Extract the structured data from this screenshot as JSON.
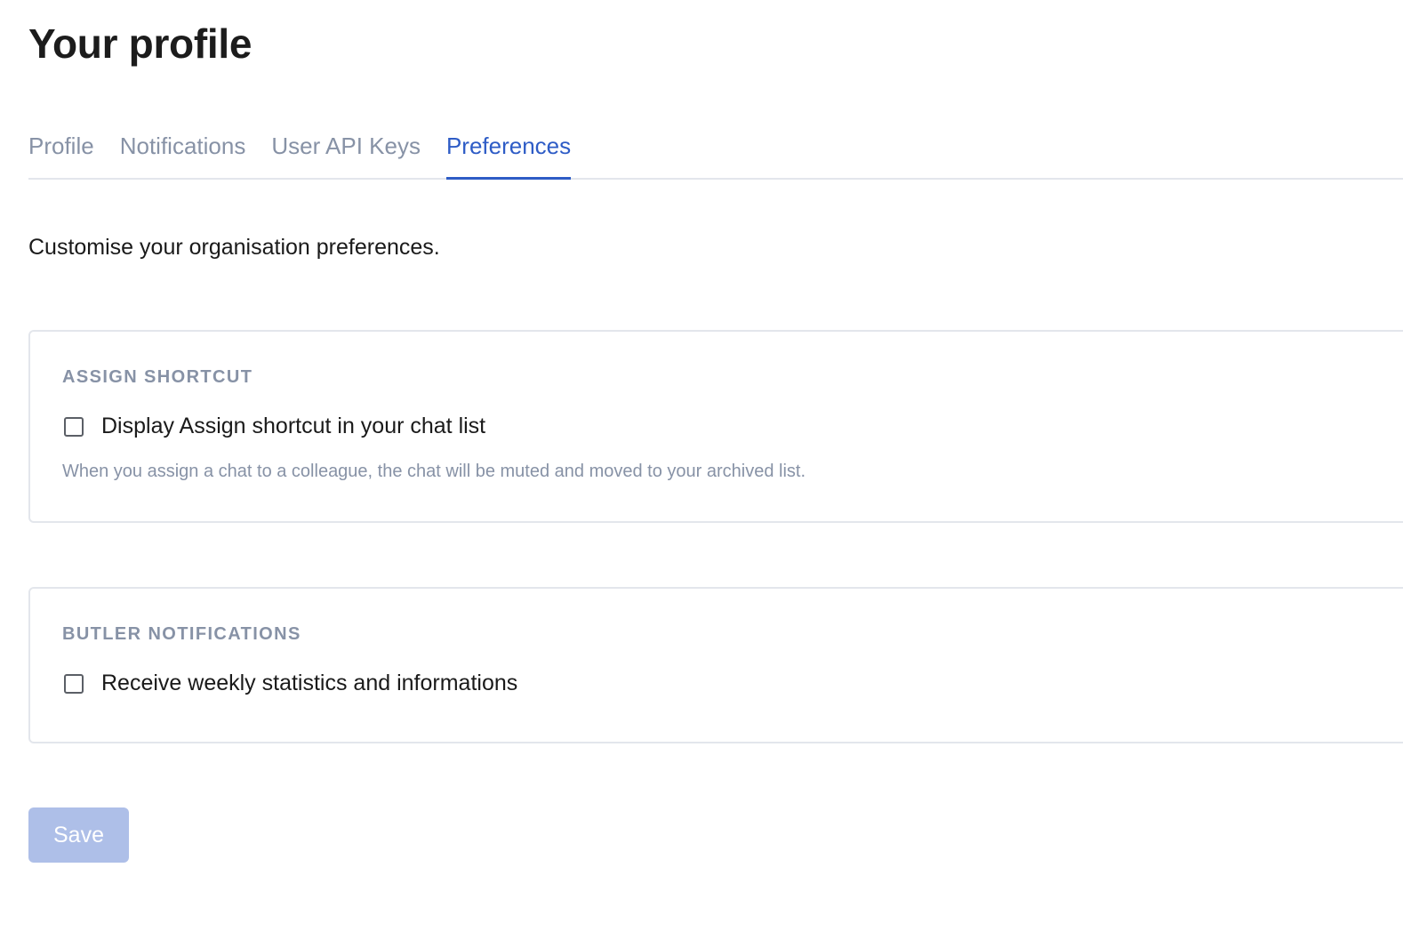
{
  "page": {
    "title": "Your profile",
    "intro": "Customise your organisation preferences."
  },
  "tabs": [
    {
      "label": "Profile",
      "active": false
    },
    {
      "label": "Notifications",
      "active": false
    },
    {
      "label": "User API Keys",
      "active": false
    },
    {
      "label": "Preferences",
      "active": true
    }
  ],
  "sections": {
    "assign_shortcut": {
      "title": "ASSIGN SHORTCUT",
      "checkbox_label": "Display Assign shortcut in your chat list",
      "checked": false,
      "help": "When you assign a chat to a colleague, the chat will be muted and moved to your archived list."
    },
    "butler_notifications": {
      "title": "BUTLER NOTIFICATIONS",
      "checkbox_label": "Receive weekly statistics and informations",
      "checked": false
    }
  },
  "actions": {
    "save_label": "Save",
    "save_enabled": false
  },
  "colors": {
    "accent": "#2e5cc6",
    "muted_text": "#8792a6",
    "save_disabled": "#aebfe8",
    "border": "#e3e6ec"
  }
}
